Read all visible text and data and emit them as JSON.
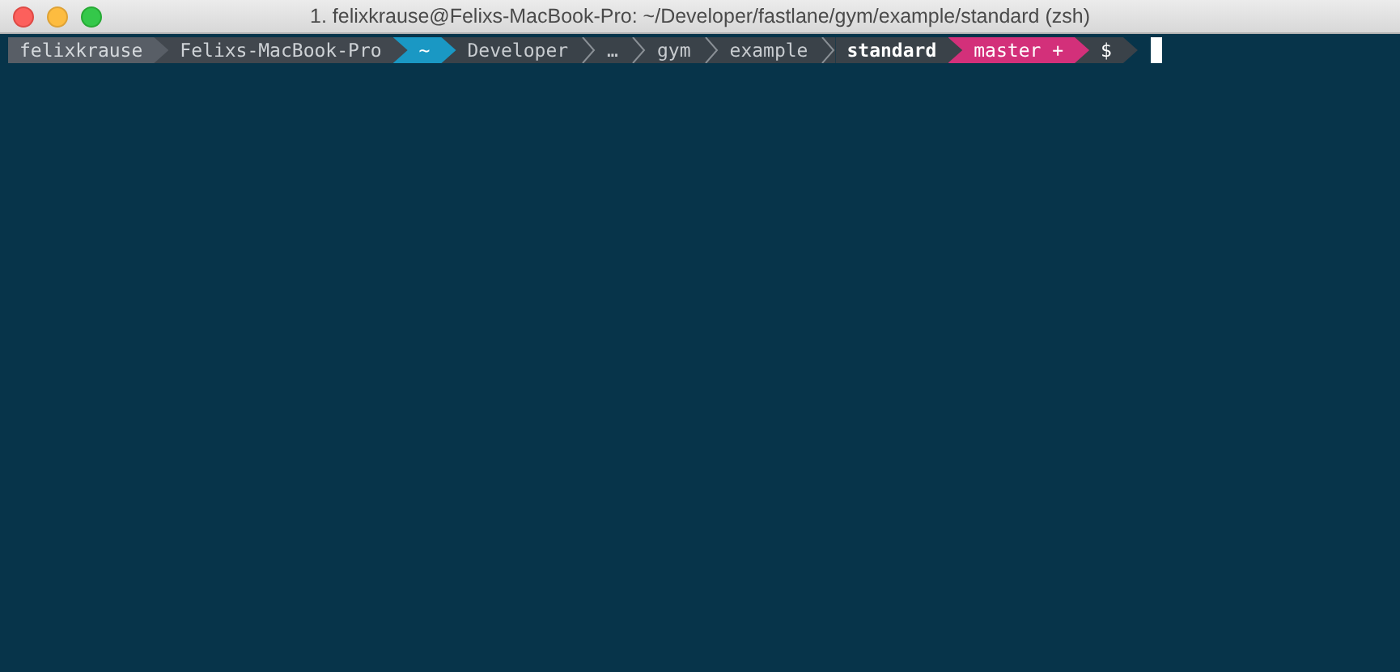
{
  "window": {
    "title": "1. felixkrause@Felixs-MacBook-Pro: ~/Developer/fastlane/gym/example/standard (zsh)"
  },
  "prompt": [
    {
      "text": "felixkrause",
      "kind": "user"
    },
    {
      "text": "Felixs-MacBook-Pro",
      "kind": "host"
    },
    {
      "text": "~",
      "kind": "home"
    },
    {
      "text": "Developer",
      "kind": "dir"
    },
    {
      "text": "…",
      "kind": "dir"
    },
    {
      "text": "gym",
      "kind": "dir"
    },
    {
      "text": "example",
      "kind": "dir"
    },
    {
      "text": "standard",
      "kind": "current"
    },
    {
      "text": "master +",
      "kind": "branch"
    },
    {
      "text": "$",
      "kind": "symbol"
    }
  ]
}
